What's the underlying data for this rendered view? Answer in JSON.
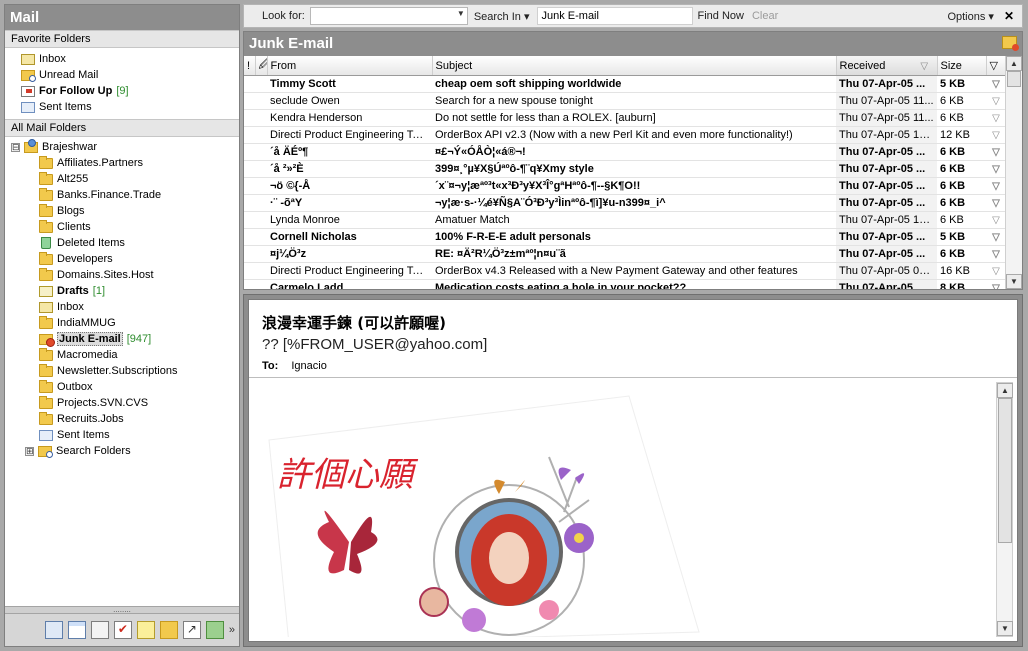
{
  "left_pane": {
    "title": "Mail",
    "favorites_header": "Favorite Folders",
    "favorites": [
      {
        "label": "Inbox",
        "icon": "inbox-icon",
        "bold": false,
        "count": ""
      },
      {
        "label": "Unread Mail",
        "icon": "unread-mail-folder-icon",
        "bold": false,
        "count": ""
      },
      {
        "label": "For Follow Up",
        "icon": "follow-up-folder-icon",
        "bold": true,
        "count": "[9]"
      },
      {
        "label": "Sent Items",
        "icon": "sent-items-icon",
        "bold": false,
        "count": ""
      }
    ],
    "all_folders_header": "All Mail Folders",
    "root": {
      "label": "Brajeshwar",
      "expander": "⊟"
    },
    "folders": [
      {
        "label": "Affiliates.Partners",
        "icon": "folder-icon",
        "bold": false,
        "count": ""
      },
      {
        "label": "Alt255",
        "icon": "folder-icon",
        "bold": false,
        "count": ""
      },
      {
        "label": "Banks.Finance.Trade",
        "icon": "folder-icon",
        "bold": false,
        "count": ""
      },
      {
        "label": "Blogs",
        "icon": "folder-icon",
        "bold": false,
        "count": ""
      },
      {
        "label": "Clients",
        "icon": "folder-icon",
        "bold": false,
        "count": ""
      },
      {
        "label": "Deleted Items",
        "icon": "deleted-items-icon",
        "bold": false,
        "count": ""
      },
      {
        "label": "Developers",
        "icon": "folder-icon",
        "bold": false,
        "count": ""
      },
      {
        "label": "Domains.Sites.Host",
        "icon": "folder-icon",
        "bold": false,
        "count": ""
      },
      {
        "label": "Drafts",
        "icon": "drafts-icon",
        "bold": true,
        "count": "[1]"
      },
      {
        "label": "Inbox",
        "icon": "inbox-icon",
        "bold": false,
        "count": ""
      },
      {
        "label": "IndiaMMUG",
        "icon": "folder-icon",
        "bold": false,
        "count": ""
      },
      {
        "label": "Junk E-mail",
        "icon": "junk-email-icon",
        "bold": true,
        "count": "[947]",
        "selected": true
      },
      {
        "label": "Macromedia",
        "icon": "folder-icon",
        "bold": false,
        "count": ""
      },
      {
        "label": "Newsletter.Subscriptions",
        "icon": "folder-icon",
        "bold": false,
        "count": ""
      },
      {
        "label": "Outbox",
        "icon": "outbox-icon",
        "bold": false,
        "count": ""
      },
      {
        "label": "Projects.SVN.CVS",
        "icon": "folder-icon",
        "bold": false,
        "count": ""
      },
      {
        "label": "Recruits.Jobs",
        "icon": "folder-icon",
        "bold": false,
        "count": ""
      },
      {
        "label": "Sent Items",
        "icon": "sent-items-icon",
        "bold": false,
        "count": ""
      }
    ],
    "search_folders": {
      "label": "Search Folders",
      "expander": "⊞"
    },
    "splitter_grip": "........",
    "nav_more": "»"
  },
  "search_bar": {
    "look_for_label": "Look for:",
    "look_for_value": "",
    "search_in_label": "Search In ▾",
    "search_in_value": "Junk E-mail",
    "find_now": "Find Now",
    "clear": "Clear",
    "options": "Options ▾",
    "close": "✕"
  },
  "message_list": {
    "title": "Junk E-mail",
    "columns": {
      "importance": "!",
      "attachment": "🖉",
      "from": "From",
      "subject": "Subject",
      "received": "Received",
      "received_sort": "▽",
      "size": "Size",
      "flag": "▽"
    },
    "rows": [
      {
        "from": "Timmy Scott",
        "subject": "cheap oem soft shipping worldwide",
        "received": "Thu 07-Apr-05 ...",
        "size": "5 KB",
        "unread": true
      },
      {
        "from": "seclude Owen",
        "subject": "Search for a new spouse tonight",
        "received": "Thu 07-Apr-05 11...",
        "size": "6 KB",
        "unread": false
      },
      {
        "from": "Kendra Henderson",
        "subject": "Do not settle for less than a ROLEX.    [auburn]",
        "received": "Thu 07-Apr-05 11...",
        "size": "6 KB",
        "unread": false
      },
      {
        "from": "Directi Product Engineering Team",
        "subject": "OrderBox API v2.3 (Now with a new Perl Kit and even more functionality!)",
        "received": "Thu 07-Apr-05 10...",
        "size": "12 KB",
        "unread": false
      },
      {
        "from": "´å ÄÉº¶",
        "subject": "¤£¬Ý«ÓÅÒ¦«á®¬!",
        "received": "Thu 07-Apr-05 ...",
        "size": "6 KB",
        "unread": true
      },
      {
        "from": "´å ²»²È",
        "subject": "399¤¸°µ¥X§Úªºô-¶¨q¥Xmy style",
        "received": "Thu 07-Apr-05 ...",
        "size": "6 KB",
        "unread": true
      },
      {
        "from": "¬ö ©{-Å",
        "subject": "´x¨¤¬y¦æªº³t«x³Ð³y¥X³Î°gªHªºô-¶--§K¶O!!",
        "received": "Thu 07-Apr-05 ...",
        "size": "6 KB",
        "unread": true
      },
      {
        "from": "·¨ -õªY",
        "subject": "¬y¦æ·s-·¼é¥Ñ§A¨Ó³Ð³y³Ìinªºô-¶ì]¥u-n399¤_i^",
        "received": "Thu 07-Apr-05 ...",
        "size": "6 KB",
        "unread": true
      },
      {
        "from": "Lynda Monroe",
        "subject": "Amatuer Match",
        "received": "Thu 07-Apr-05 10...",
        "size": "6 KB",
        "unread": false
      },
      {
        "from": "Cornell Nicholas",
        "subject": "100% F-R-E-E adult personals",
        "received": "Thu 07-Apr-05 ...",
        "size": "5 KB",
        "unread": true
      },
      {
        "from": "¤j¼Ö³z",
        "subject": "RE: ¤Ä²R¼Ö³z±mªº¦n¤u¨ã",
        "received": "Thu 07-Apr-05 ...",
        "size": "6 KB",
        "unread": true
      },
      {
        "from": "Directi Product Engineering Team",
        "subject": "OrderBox v4.3 Released with a New Payment Gateway and other features",
        "received": "Thu 07-Apr-05 09...",
        "size": "16 KB",
        "unread": false
      },
      {
        "from": "Carmelo Ladd",
        "subject": "Medication costs eating a hole in your pocket??",
        "received": "Thu 07-Apr-05 ...",
        "size": "8 KB",
        "unread": true
      }
    ]
  },
  "reading_pane": {
    "subject": "浪漫幸運手鍊 (可以許願喔)",
    "from": "?? [%FROM_USER@yahoo.com]",
    "to_label": "To:",
    "to_value": "Ignacio",
    "image_caption": "許個心願",
    "colors": {
      "caption": "#d9232e",
      "hair": "#c9382a",
      "butterfly": "#c8364a",
      "flower": "#9b63c9"
    }
  },
  "colors": {
    "title_bar": "#8d8d8d",
    "count_green": "#2d8c2d",
    "pane_bg": "#ffffff"
  }
}
